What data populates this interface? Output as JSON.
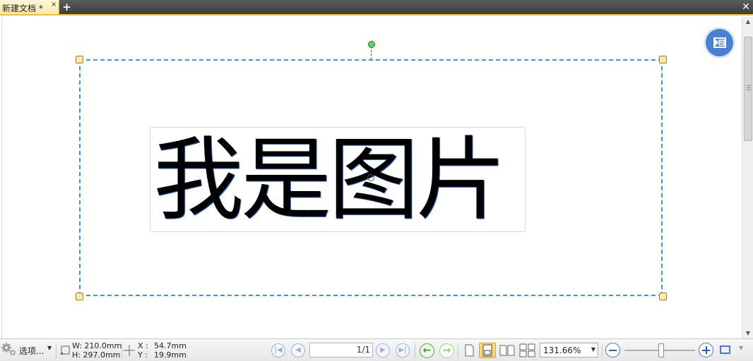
{
  "tabs": {
    "active_tab_title": "新建文档 *",
    "close_glyph": "×",
    "add_glyph": "+",
    "window_close_glyph": "✕"
  },
  "canvas": {
    "image_text": "我是图片",
    "floating_action_icon": "edit-image-icon"
  },
  "status": {
    "options_label": "选项...",
    "width_label": "W: 210.0mm",
    "height_label": "H: 297.0mm",
    "x_label": "X :",
    "x_value": "54.7mm",
    "y_label": "Y :",
    "y_value": "19.9mm",
    "page_indicator": "1/1",
    "zoom_value": "131.66%",
    "zoom_level_fraction": 0.52
  },
  "colors": {
    "accent_tab": "#fde9a9",
    "selection": "#4a8fd8",
    "fab": "#4a7fd6",
    "active_view": "#fbd676"
  }
}
